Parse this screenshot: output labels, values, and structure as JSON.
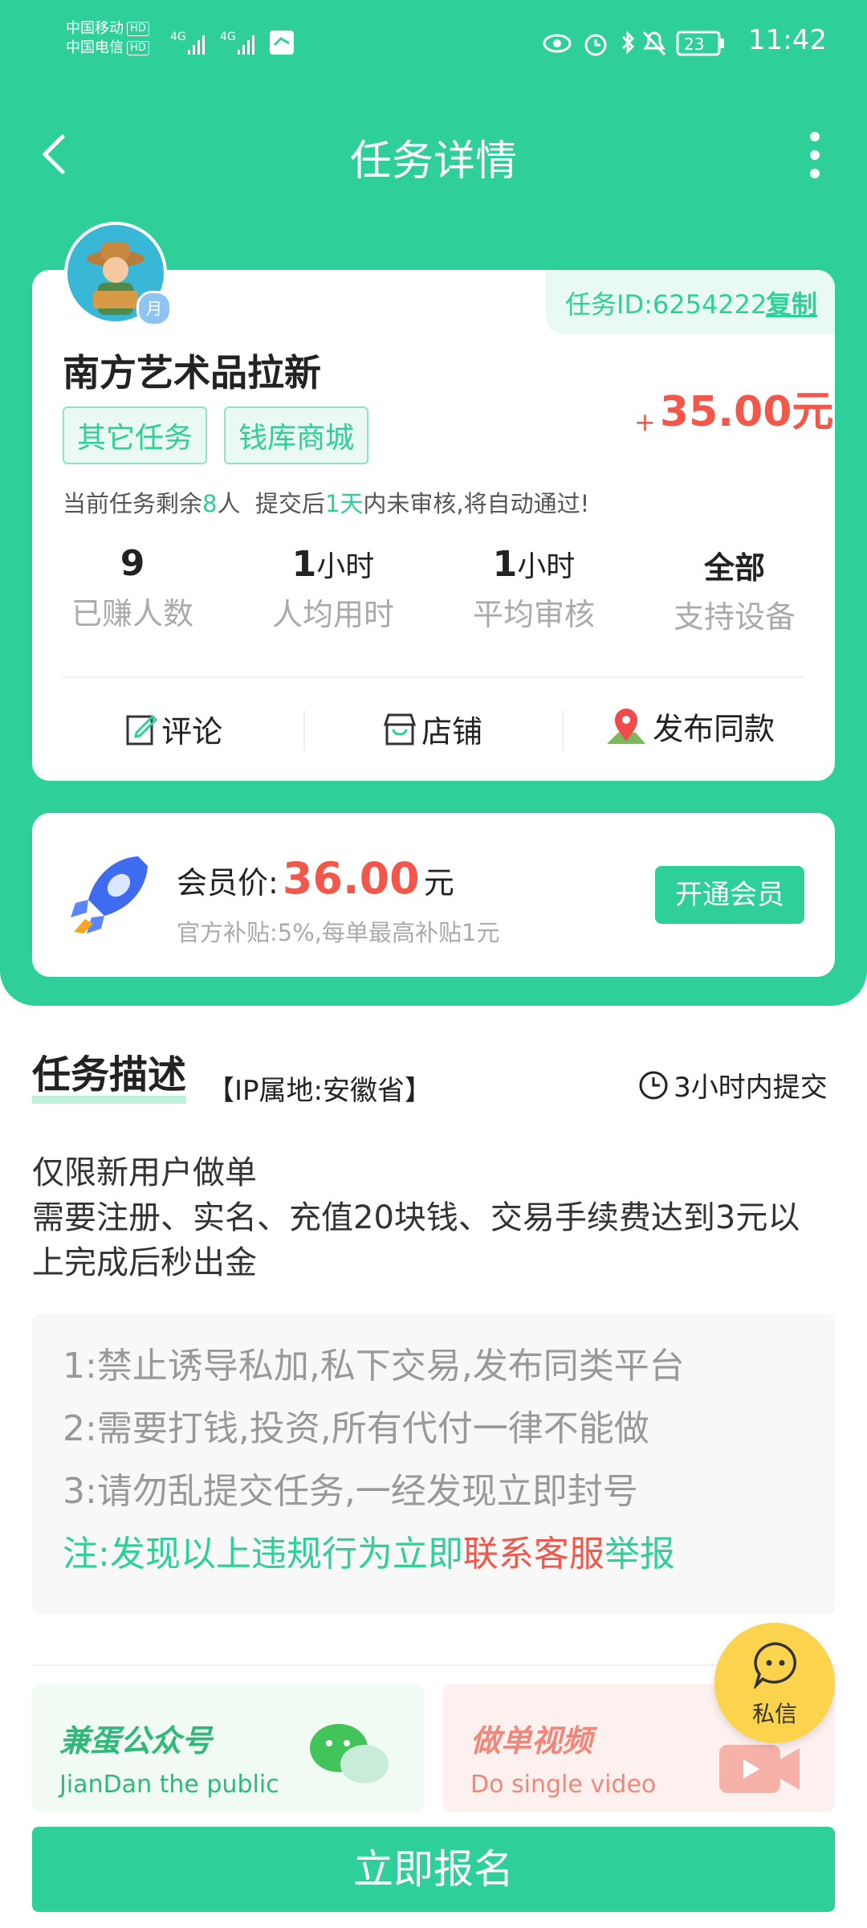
{
  "status_bar": {
    "carrier1": "中国移动",
    "carrier2": "中国电信",
    "hd": "HD",
    "net": "4G",
    "battery": "23",
    "time": "11:42"
  },
  "nav": {
    "title": "任务详情"
  },
  "task": {
    "id_text": "任务ID:6254222",
    "copy_label": "复制",
    "avatar_badge": "月",
    "name": "南方艺术品拉新",
    "tags": [
      "其它任务",
      "钱库商城"
    ],
    "reward_plus": "+",
    "reward": "35.00元",
    "remaining_pre": "当前任务剩余",
    "remaining_num": "8",
    "remaining_unit": "人",
    "auto_pre": "提交后",
    "auto_days": "1天",
    "auto_post": "内未审核,将自动通过!",
    "stats": [
      {
        "num": "9",
        "unit": "",
        "label": "已赚人数"
      },
      {
        "num": "1",
        "unit": "小时",
        "label": "人均用时"
      },
      {
        "num": "1",
        "unit": "小时",
        "label": "平均审核"
      },
      {
        "num": "全部",
        "unit": "",
        "label": "支持设备"
      }
    ],
    "actions": {
      "comment": "评论",
      "store": "店铺",
      "publish": "发布同款"
    }
  },
  "member": {
    "label": "会员价:",
    "price": "36.00",
    "unit": "元",
    "subsidy": "官方补贴:5%,每单最高补贴1元",
    "button": "开通会员"
  },
  "description": {
    "heading": "任务描述",
    "ip": "【IP属地:安徽省】",
    "deadline": "3小时内提交",
    "lines": [
      "仅限新用户做单",
      "需要注册、实名、充值20块钱、交易手续费达到3元以",
      "上完成后秒出金"
    ],
    "rules": [
      "1:禁止诱导私加,私下交易,发布同类平台",
      "2:需要打钱,投资,所有代付一律不能做",
      "3:请勿乱提交任务,一经发现立即封号"
    ],
    "note_green": "注:发现以上违规行为立即",
    "note_red": "联系客服",
    "note_end": "举报"
  },
  "promos": [
    {
      "title": "兼蛋公众号",
      "subtitle": "JianDan the public"
    },
    {
      "title": "做单视频",
      "subtitle": "Do single video"
    }
  ],
  "float": {
    "label": "私信"
  },
  "signup": {
    "button": "立即报名"
  },
  "colors": {
    "brand": "#2ecf98",
    "price_red": "#f2584a",
    "float_yellow": "#fbd34d"
  }
}
